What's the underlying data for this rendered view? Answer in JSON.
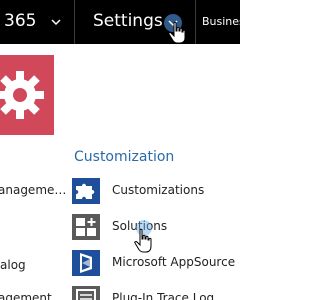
{
  "topbar": {
    "product_label": "365",
    "settings_label": "Settings",
    "business_label": "Busines"
  },
  "left_nav": {
    "items": [
      "anageme…",
      "alog",
      "agement"
    ]
  },
  "customization": {
    "title": "Customization",
    "items": [
      {
        "label": "Customizations",
        "icon": "puzzle-icon"
      },
      {
        "label": "Solutions",
        "icon": "solutions-icon"
      },
      {
        "label": "Microsoft AppSource",
        "icon": "appsource-icon"
      },
      {
        "label": "Plug-In Trace Log",
        "icon": "trace-log-icon"
      }
    ]
  },
  "colors": {
    "topbar_bg": "#000000",
    "accent": "#2a6aa8",
    "tile_pink": "#d0485a",
    "icon_blue": "#1f4f9a",
    "icon_gray": "#5a5a5a"
  }
}
